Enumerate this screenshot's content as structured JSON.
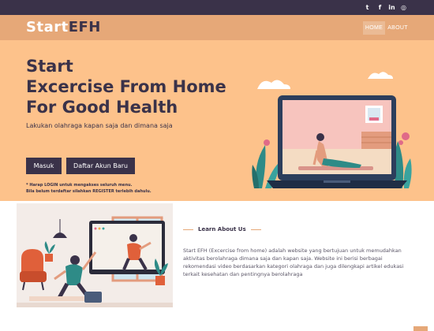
{
  "topbar": {
    "social": [
      {
        "name": "twitter-icon",
        "glyph": "t"
      },
      {
        "name": "facebook-icon",
        "glyph": "f"
      },
      {
        "name": "linkedin-icon",
        "glyph": "in"
      },
      {
        "name": "instagram-icon",
        "glyph": "◎"
      }
    ]
  },
  "navbar": {
    "brand_part1": "Start",
    "brand_part2": "EFH",
    "home": "HOME",
    "about": "ABOUT"
  },
  "hero": {
    "title_line1": "Start",
    "title_line2": "Excercise From Home",
    "title_line3": "For Good Health",
    "subtitle": "Lakukan olahraga kapan saja dan dimana saja",
    "login_button": "Masuk",
    "register_button": "Daftar Akun Baru",
    "note_line1": "* Harap LOGIN untuk mengakses seluruh menu.",
    "note_line2": "Bila belum terdaftar silahkan REGISTER terlebih dahulu."
  },
  "about": {
    "heading": "Learn About Us",
    "text": "Start EFH (Excercise from home) adalah website yang bertujuan untuk memudahkan aktivitas berolahraga dimana saja dan kapan saja. Website ini berisi berbagai rekomendasi video berdasarkan kategori olahraga dan juga dilengkapi artikel edukasi terkait kesehatan dan pentingnya berolahraga"
  },
  "colors": {
    "dark": "#3a3249",
    "nav": "#e6a878",
    "hero_bg": "#fdc28b",
    "accent_teal": "#2e8b87"
  }
}
